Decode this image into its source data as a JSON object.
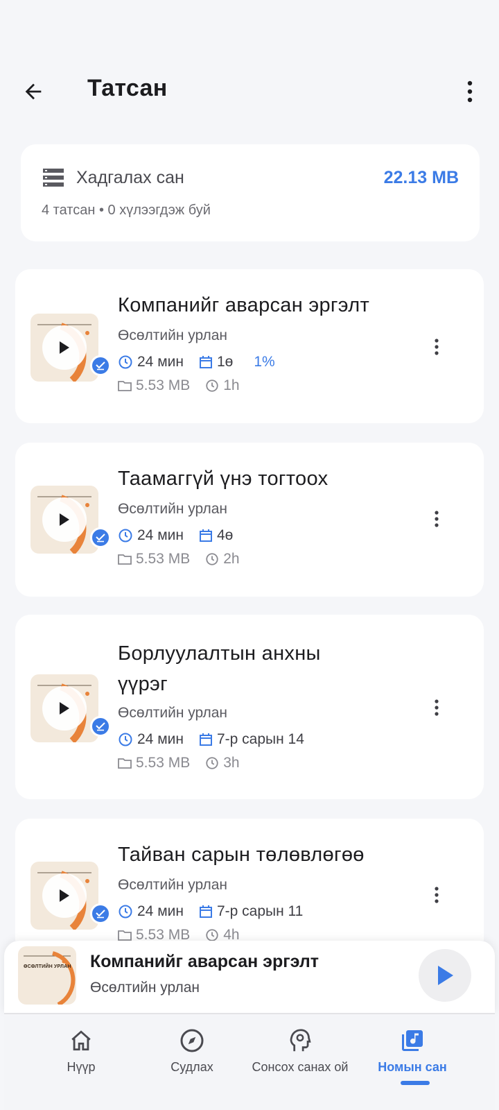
{
  "header": {
    "title": "Татсан"
  },
  "storage": {
    "label": "Хадгалах сан",
    "size": "22.13 MB",
    "summary": "4 татсан • 0 хүлээгдэж буй"
  },
  "tracks": [
    {
      "title": "Компанийг аварсан эргэлт",
      "artist": "Өсөлтийн урлан",
      "duration": "24 мин",
      "date": "1ө",
      "progress": "1%",
      "file_size": "5.53 MB",
      "age": "1h"
    },
    {
      "title": "Таамаггүй үнэ тогтоох",
      "artist": "Өсөлтийн урлан",
      "duration": "24 мин",
      "date": "4ө",
      "file_size": "5.53 MB",
      "age": "2h"
    },
    {
      "title": "Борлуулалтын анхны үүрэг",
      "artist": "Өсөлтийн урлан",
      "duration": "24 мин",
      "date": "7-р сарын 14",
      "file_size": "5.53 MB",
      "age": "3h"
    },
    {
      "title": "Тайван сарын төлөвлөгөө",
      "artist": "Өсөлтийн урлан",
      "duration": "24 мин",
      "date": "7-р сарын 11",
      "file_size": "5.53 MB",
      "age": "4h"
    }
  ],
  "mini_player": {
    "title": "Компанийг аварсан эргэлт",
    "artist": "Өсөлтийн урлан",
    "thumb_text": "ӨСӨЛТИЙН УРЛАН"
  },
  "nav": {
    "items": [
      {
        "label": "Нүүр",
        "icon": "home-icon"
      },
      {
        "label": "Судлах",
        "icon": "compass-icon"
      },
      {
        "label": "Сонсох санах ой",
        "icon": "brain-icon"
      },
      {
        "label": "Номын сан",
        "icon": "library-music-icon",
        "active": true
      }
    ]
  },
  "colors": {
    "accent": "#3b7be6",
    "thumb_bg": "#f3e9dc",
    "thumb_arc": "#e8833a"
  }
}
